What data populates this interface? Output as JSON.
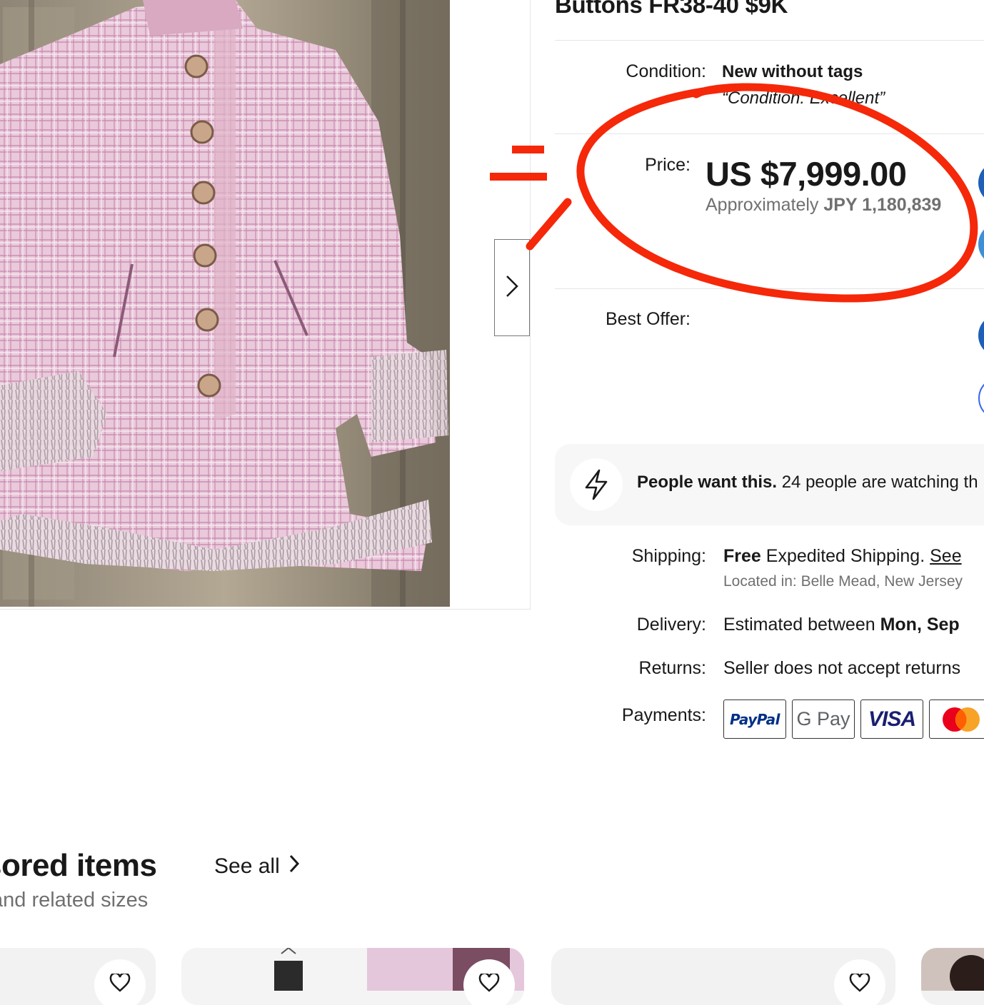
{
  "listing": {
    "title": "Buttons FR38-40 $9K",
    "condition_label": "Condition:",
    "condition_value": "New without tags",
    "condition_note": "“Condition: Excellent”",
    "price_label": "Price:",
    "price_value": "US $7,999.00",
    "price_approx_prefix": "Approximately",
    "price_approx_value": "JPY 1,180,839",
    "best_offer_label": "Best Offer:"
  },
  "signal": {
    "bold": "People want this.",
    "text": "24 people are watching th"
  },
  "shipping": {
    "label": "Shipping:",
    "free": "Free",
    "method": "Expedited Shipping.",
    "link": "See",
    "location": "Located in: Belle Mead, New Jersey"
  },
  "delivery": {
    "label": "Delivery:",
    "prefix": "Estimated between",
    "date": "Mon, Sep"
  },
  "returns": {
    "label": "Returns:",
    "value": "Seller does not accept returns"
  },
  "payments": {
    "label": "Payments:",
    "methods": [
      "PayPal",
      "G Pay",
      "VISA",
      "Mastercard"
    ]
  },
  "sponsored": {
    "heading": "sored items",
    "subheading": "and related sizes",
    "see_all": "See all"
  },
  "annotation": {
    "color": "#f5280a",
    "mark": "="
  },
  "colors": {
    "ebay_blue": "#3665f3",
    "text_primary": "#191919",
    "text_muted": "#707070"
  },
  "icons": [
    "chevron-right-icon",
    "lightning-bolt-icon",
    "heart-icon"
  ]
}
